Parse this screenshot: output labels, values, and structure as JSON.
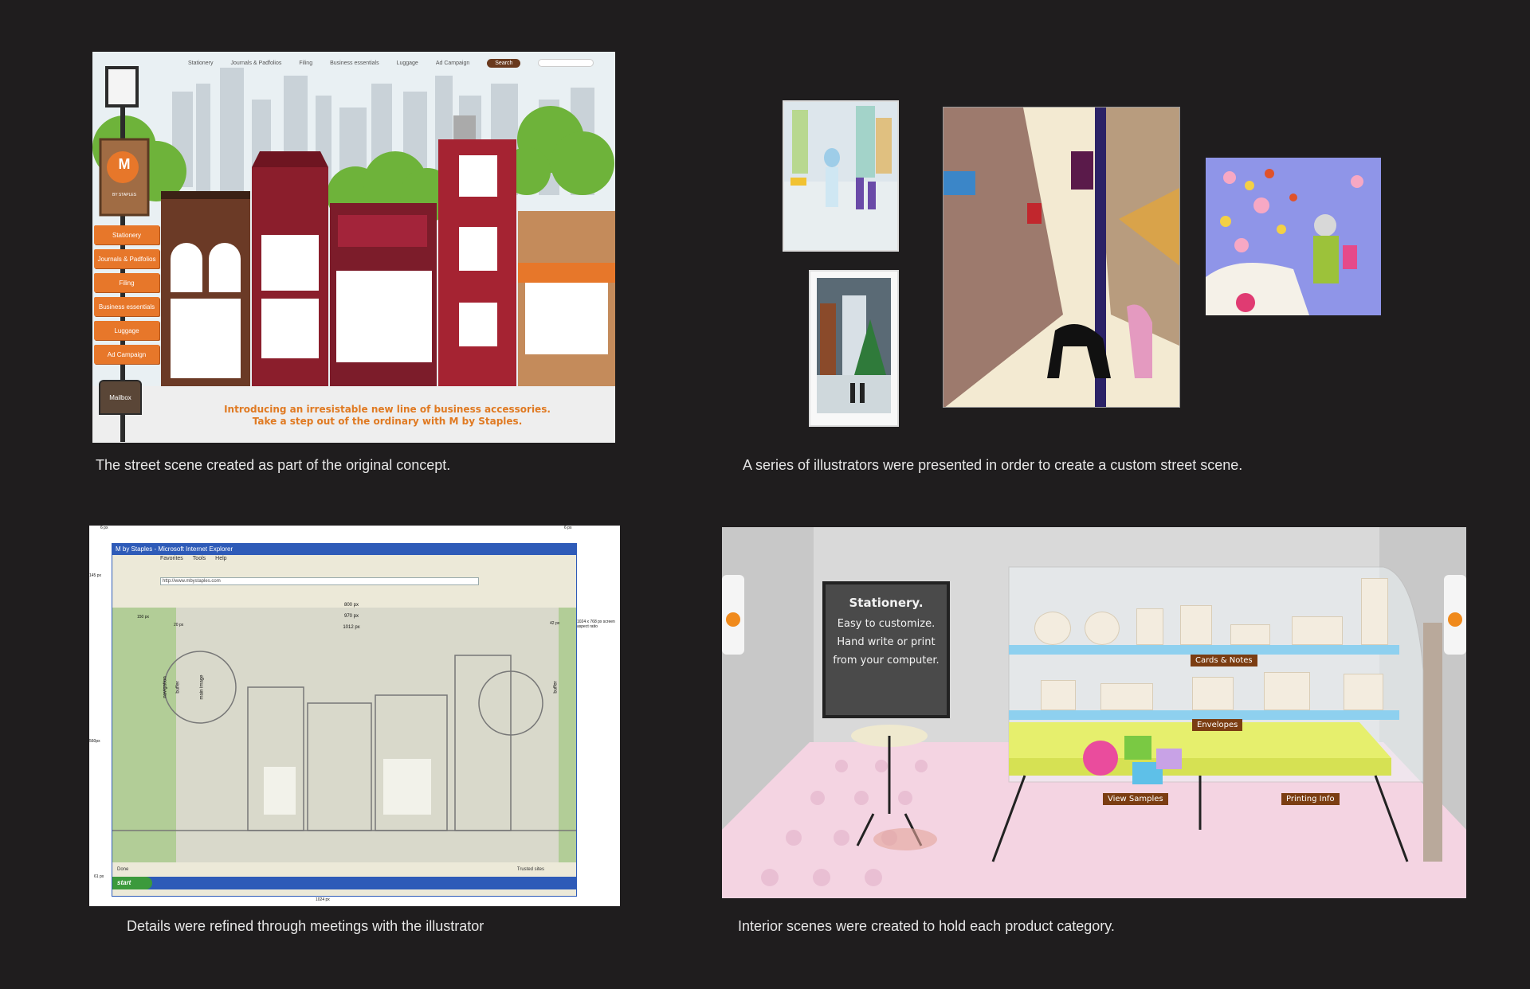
{
  "panels": {
    "street": {
      "caption": "The street scene created as part of the original concept.",
      "nav": [
        "Stationery",
        "Journals & Padfolios",
        "Filing",
        "Business essentials",
        "Luggage",
        "Ad Campaign"
      ],
      "search_label": "Search",
      "sidebar": [
        "Stationery",
        "Journals & Padfolios",
        "Filing",
        "Business essentials",
        "Luggage",
        "Ad Campaign"
      ],
      "mailbox_label": "Mailbox",
      "logo_letter": "M",
      "logo_sub": "BY STAPLES",
      "tagline_1": "Introducing an irresistable new line of business accessories.",
      "tagline_2": "Take a step out of the ordinary with M by Staples."
    },
    "illustrators": {
      "caption": "A series of illustrators were presented in order to create a custom street scene."
    },
    "sketch": {
      "caption": "Details were refined through meetings with the illustrator",
      "browser_title": "M by Staples - Microsoft Internet Explorer",
      "address": "http://www.mbystaples.com",
      "menu": [
        "Favorites",
        "Tools",
        "Help"
      ],
      "status_left": "Done",
      "status_right": "Trusted sites",
      "start_label": "start",
      "dims": {
        "w800": "800 px",
        "w970": "970 px",
        "w1012": "1012 px",
        "w1024": "1024 px",
        "h145": "145 px",
        "h560": "560px",
        "h61": "61 px",
        "p6": "6 px",
        "p150": "150 px",
        "p20": "20 px",
        "p42": "42 px",
        "aspect": "1024 x 768 px screen aspect ratio"
      },
      "zone_labels": [
        "navigation",
        "buffer",
        "main image",
        "buffer"
      ]
    },
    "interior": {
      "caption": "Interior scenes were created to hold each product category.",
      "board_title": "Stationery.",
      "board_lines": [
        "Easy to customize.",
        "Hand write or print",
        "from your computer."
      ],
      "tags": [
        "Cards & Notes",
        "Envelopes",
        "View Samples",
        "Printing Info"
      ]
    }
  },
  "colors": {
    "background": "#1f1d1e",
    "accent_orange": "#e7772a",
    "brick_red": "#8b1e2c",
    "shelf_blue": "#8ed0ef"
  }
}
